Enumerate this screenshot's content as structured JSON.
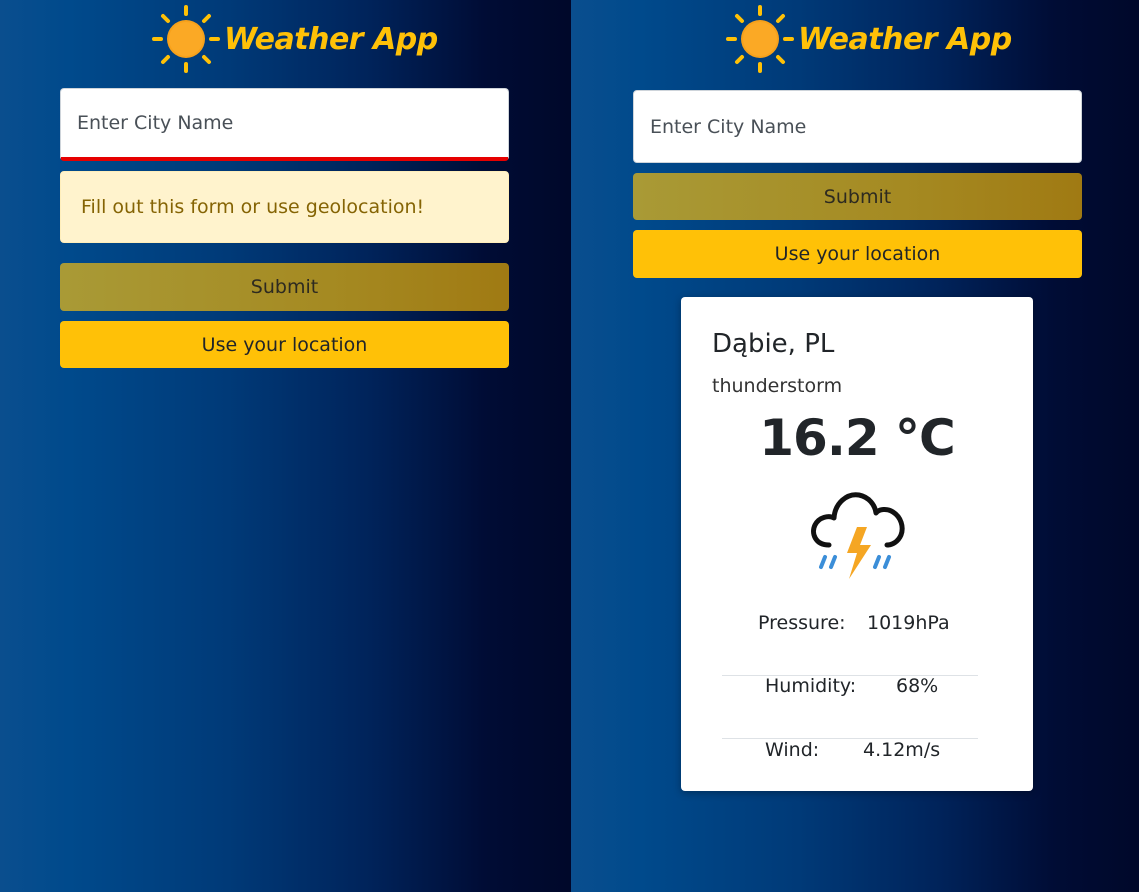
{
  "app": {
    "title": "Weather App"
  },
  "colors": {
    "accent": "#ffc107",
    "error": "#e60000",
    "alert_bg": "#fff3cd"
  },
  "left": {
    "search": {
      "placeholder": "Enter City Name"
    },
    "alert": "Fill out this form or use geolocation!",
    "submit_label": "Submit",
    "location_label": "Use your location"
  },
  "right": {
    "search": {
      "placeholder": "Enter City Name"
    },
    "submit_label": "Submit",
    "location_label": "Use your location",
    "weather": {
      "city": "Dąbie, PL",
      "description": "thunderstorm",
      "temperature": "16.2 °C",
      "icon": "thunderstorm-icon",
      "details": [
        {
          "label": "Pressure:",
          "value": "1019hPa"
        },
        {
          "label": "Humidity:",
          "value": "68%"
        },
        {
          "label": "Wind:",
          "value": "4.12m/s"
        }
      ]
    }
  }
}
